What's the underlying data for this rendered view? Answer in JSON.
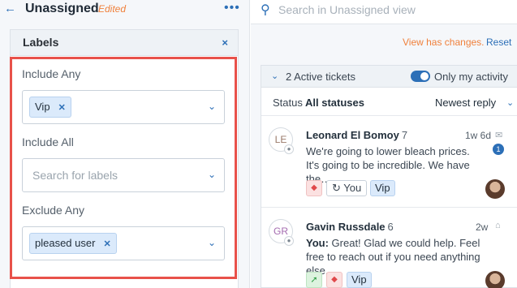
{
  "header": {
    "back_icon": "back-arrow-icon",
    "title": "Unassigned",
    "edited": "Edited",
    "more_icon": "more-dots-icon"
  },
  "labels": {
    "title": "Labels",
    "close": "×",
    "include_any": {
      "label": "Include Any",
      "chips": [
        "Vip"
      ]
    },
    "include_all": {
      "label": "Include All",
      "placeholder": "Search for labels"
    },
    "exclude_any": {
      "label": "Exclude Any",
      "chips": [
        "pleased user"
      ]
    },
    "highlight_color": "#e8514a"
  },
  "search": {
    "placeholder": "Search in Unassigned view"
  },
  "changes": {
    "text": "View has changes.",
    "reset": "Reset"
  },
  "tickets": {
    "count_label": "2 Active tickets",
    "only_my_activity": "Only my activity",
    "only_my_activity_on": true,
    "status_label": "Status",
    "status_value": "All statuses",
    "sort_label": "Newest reply",
    "items": [
      {
        "initials": "LE",
        "initials_color": "#9a7a6a",
        "name": "Leonard El Bomoy",
        "count": "7",
        "time": "1w 6d",
        "unread": "1",
        "preview": "We're going to lower bleach prices. It's going to be incredible. We have the…",
        "tag_you": "You",
        "tag_label": "Vip"
      },
      {
        "initials": "GR",
        "initials_color": "#a46bb0",
        "name": "Gavin Russdale",
        "count": "6",
        "time": "2w",
        "preview_prefix": "You:",
        "preview": "Great! Glad we could help. Feel free to reach out if you need anything else.",
        "tag_label": "Vip"
      }
    ]
  },
  "colors": {
    "accent": "#2c6fb7",
    "warning": "#f0813c"
  }
}
